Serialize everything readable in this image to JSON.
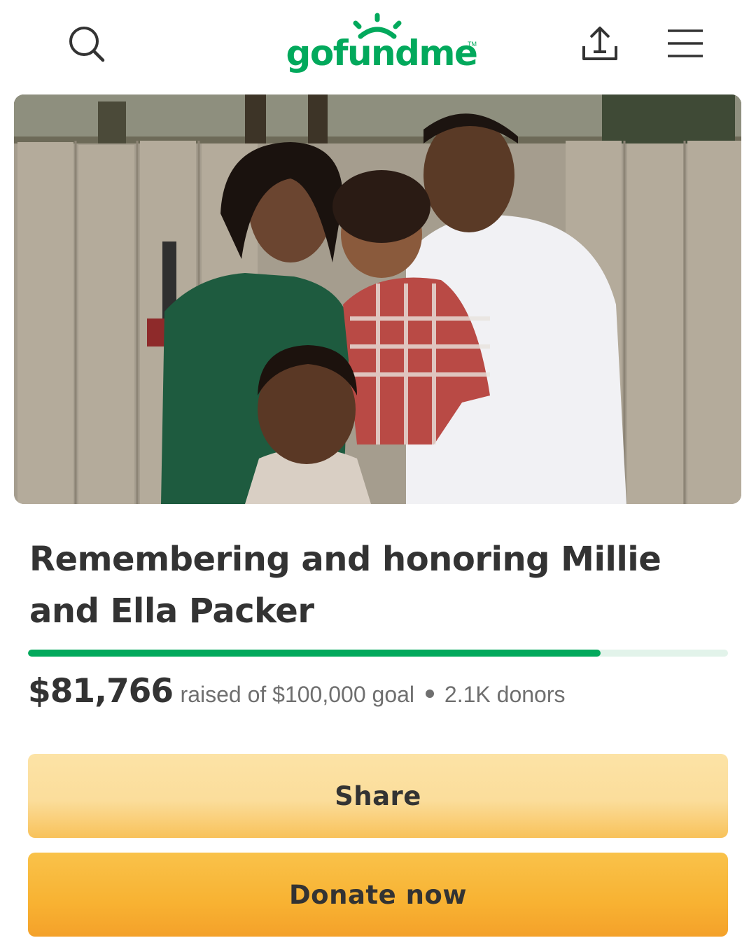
{
  "header": {
    "logo_text": "gofundme",
    "logo_tm": "TM",
    "search_icon": "search-icon",
    "share_icon": "share-upload-icon",
    "menu_icon": "hamburger-menu-icon",
    "brand_color": "#02a95c"
  },
  "hero": {
    "image": "family-photo"
  },
  "campaign": {
    "title": "Remembering and honoring Millie and Ella Packer",
    "raised": "$81,766",
    "raised_text": "raised of $100,000 goal",
    "donors": "2.1K donors",
    "progress_fraction": 0.818
  },
  "actions": {
    "share_label": "Share",
    "donate_label": "Donate now"
  }
}
